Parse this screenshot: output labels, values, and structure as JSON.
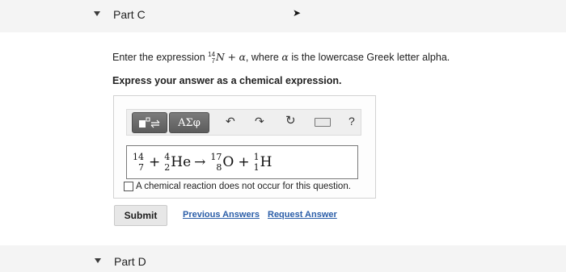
{
  "part_c": {
    "title": "Part C"
  },
  "question": {
    "prefix": "Enter the expression",
    "nuclide_mass": "14",
    "nuclide_atomic": "7",
    "nuclide_symbol": "N",
    "plus": "+",
    "alpha": "α",
    "middle": ", where",
    "alpha2": "α",
    "suffix": "is the lowercase Greek letter alpha."
  },
  "instruction": "Express your answer as a chemical expression.",
  "toolbar": {
    "greek_label": "ΑΣφ",
    "undo_icon": "undo-icon",
    "redo_icon": "redo-icon",
    "reset_icon": "reset-icon",
    "keyboard_icon": "keyboard-icon",
    "help_label": "?"
  },
  "answer": {
    "n_mass": "14",
    "n_atomic": "7",
    "plus1": "+",
    "he_mass": "4",
    "he_atomic": "2",
    "he_symbol": "He",
    "arrow": "→",
    "o_mass": "17",
    "o_atomic": "8",
    "o_symbol": "O",
    "plus2": "+",
    "h_mass": "1",
    "h_atomic": "1",
    "h_symbol": "H"
  },
  "no_reaction_label": "A chemical reaction does not occur for this question.",
  "actions": {
    "submit_label": "Submit",
    "previous_answers": "Previous Answers",
    "request_answer": "Request Answer"
  },
  "part_d": {
    "title": "Part D"
  }
}
